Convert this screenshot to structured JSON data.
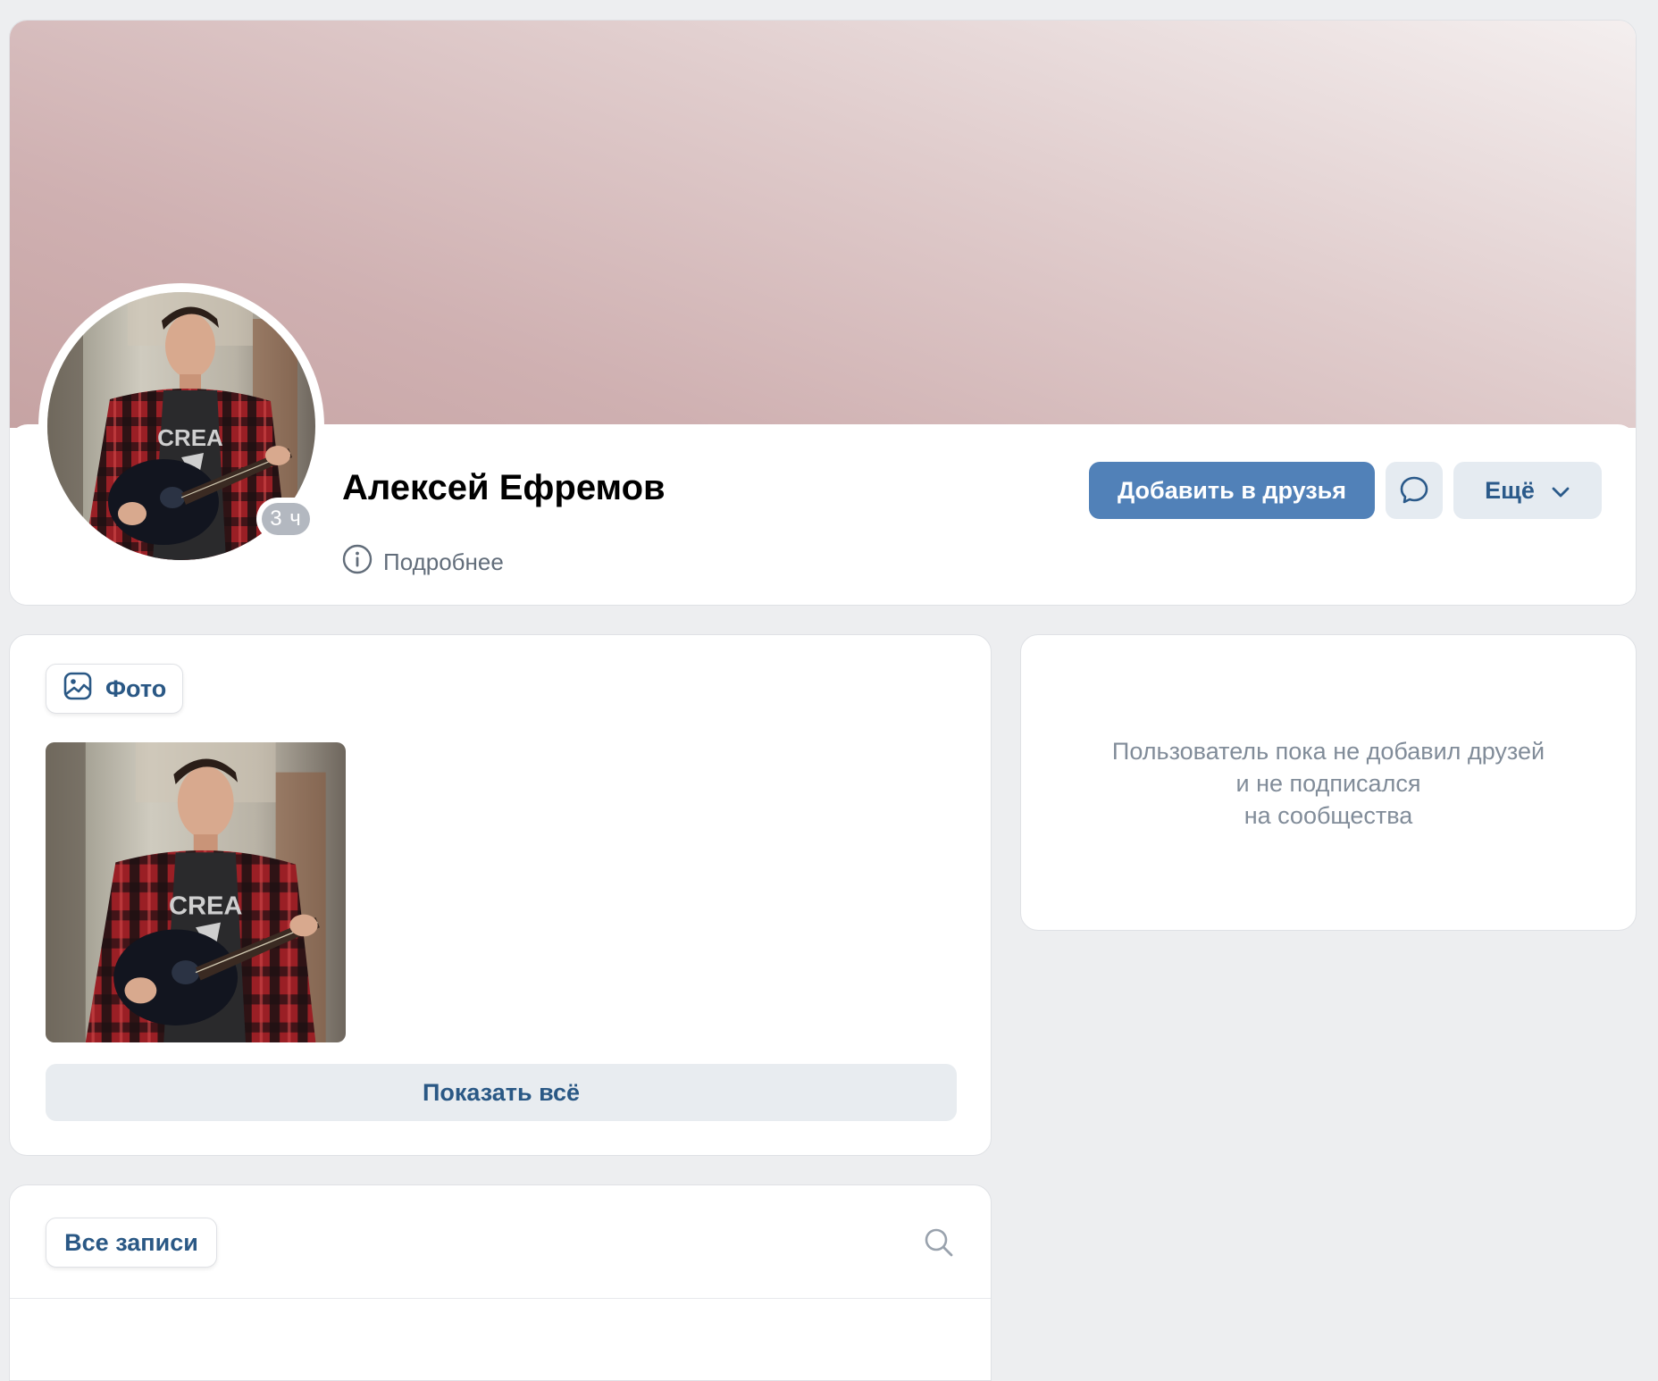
{
  "profile": {
    "name": "Алексей Ефремов",
    "last_seen": "3 ч",
    "details_label": "Подробнее"
  },
  "actions": {
    "add_friend_label": "Добавить в друзья",
    "message_icon": "message-bubble-icon",
    "more_label": "Ещё"
  },
  "photos": {
    "tab_label": "Фото",
    "show_all_label": "Показать всё"
  },
  "friends": {
    "empty_lines": [
      "Пользователь пока не добавил друзей",
      "и не подписался",
      "на сообщества"
    ]
  },
  "wall": {
    "tab_label": "Все записи"
  },
  "colors": {
    "primary": "#5181b8",
    "link": "#2a5885",
    "page_bg": "#edeef0"
  }
}
